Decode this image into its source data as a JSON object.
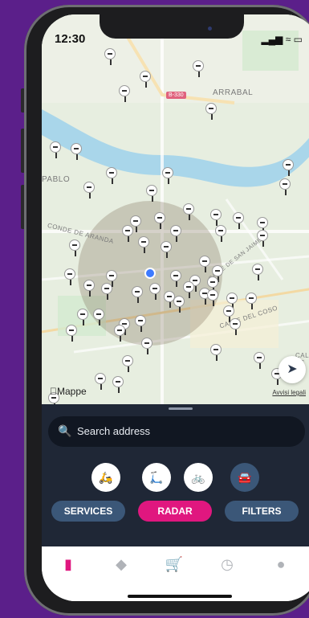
{
  "status": {
    "time": "12:30",
    "indicators": "▂▄▆ ≈ ▭"
  },
  "map": {
    "labels": [
      "ARRABAL",
      "PABLO",
      "CONDE DE ARANDA",
      "CALLE DEL COSO",
      "CALLE DE SAN JAIME I",
      "CALLE AS"
    ],
    "road_badge": "B-330",
    "attribution": "Mappe",
    "legal": "Avvisi legali"
  },
  "search": {
    "placeholder": "Search address",
    "icon": "search-icon"
  },
  "vehicle_filters": [
    {
      "name": "moped",
      "icon": "moped-icon",
      "selected": false
    },
    {
      "name": "kick-scooter",
      "icon": "kick-scooter-icon",
      "selected": false
    },
    {
      "name": "bike",
      "icon": "bike-icon",
      "selected": false
    },
    {
      "name": "car",
      "icon": "car-icon",
      "selected": true
    }
  ],
  "actions": {
    "services": "SERVICES",
    "radar": "RADAR",
    "filters": "FILTERS"
  },
  "colors": {
    "accent": "#e0177f",
    "panel": "#1f2736",
    "pill": "#3b5778",
    "frame": "#5b1f8a"
  },
  "tabs": [
    "map-icon",
    "tag-icon",
    "cart-icon",
    "history-icon",
    "profile-icon"
  ]
}
